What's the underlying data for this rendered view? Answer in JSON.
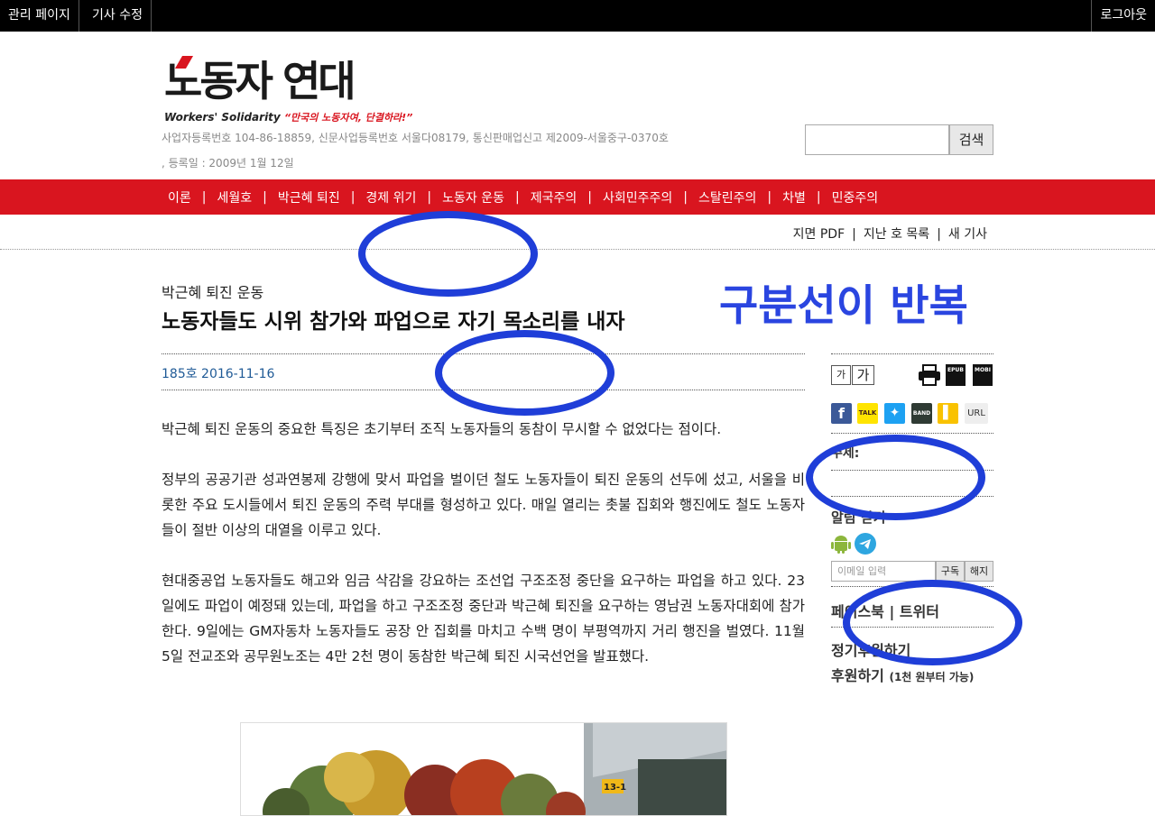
{
  "admin_bar": {
    "admin_page": "관리 페이지",
    "edit_article": "기사 수정",
    "logout": "로그아웃"
  },
  "header": {
    "logo_text": "노동자 연대",
    "logo_english": "Workers' Solidarity",
    "logo_slogan": "“만국의 노동자여, 단결하라!”",
    "registration_line1": "사업자등록번호 104-86-18859, 신문사업등록번호 서울다08179, 통신판매업신고 제2009-서울중구-0370호",
    "registration_line2": ", 등록일 : 2009년 1월 12일",
    "search_placeholder": "",
    "search_button": "검색"
  },
  "nav": {
    "items": [
      "이론",
      "세월호",
      "박근혜 퇴진",
      "경제 위기",
      "노동자 운동",
      "제국주의",
      "사회민주주의",
      "스탈린주의",
      "차별",
      "민중주의"
    ]
  },
  "subnav": {
    "pdf": "지면 PDF",
    "past_issues": "지난 호 목록",
    "new_articles": "새 기사"
  },
  "article": {
    "category": "박근혜 퇴진 운동",
    "title": "노동자들도 시위 참가와 파업으로 자기 목소리를 내자",
    "issue_date": "185호 2016-11-16",
    "paragraphs": [
      "박근혜 퇴진 운동의 중요한 특징은 초기부터 조직 노동자들의 동참이 무시할 수 없었다는 점이다.",
      "정부의 공공기관 성과연봉제 강행에 맞서 파업을 벌이던 철도 노동자들이 퇴진 운동의 선두에 섰고, 서울을 비롯한 주요 도시들에서 퇴진 운동의 주력 부대를 형성하고 있다. 매일 열리는 촛불 집회와 행진에도 철도 노동자들이 절반 이상의 대열을 이루고 있다.",
      "현대중공업 노동자들도 해고와 임금 삭감을 강요하는 조선업 구조조정 중단을 요구하는 파업을 하고 있다. 23일에도 파업이 예정돼 있는데, 파업을 하고 구조조정 중단과 박근혜 퇴진을 요구하는 영남권 노동자대회에 참가한다. 9일에는 GM자동차 노동자들도 공장 안 집회를 마치고 수백 명이 부평역까지 거리 행진을 벌였다. 11월 5일 전교조와 공무원노조는 4만 2천 명이 동참한 박근혜 퇴진 시국선언을 발표했다."
    ],
    "photo_sign": "13-1"
  },
  "annotation": {
    "text": "구분선이 반복",
    "color": "#1f3ed8"
  },
  "sidebar": {
    "font_small": "가",
    "font_large": "가",
    "epub": "EPUB",
    "mobi": "MOBI",
    "share": [
      "facebook-icon",
      "kakaotalk-icon",
      "twitter-icon",
      "band-icon",
      "kakaostory-icon"
    ],
    "talk_label": "TALK",
    "band_label": "BAND",
    "url_label": "URL",
    "topic_label": "주제:",
    "alert_label": "알림 받기",
    "email_placeholder": "이메일 입력",
    "subscribe": "구독",
    "unsubscribe": "해지",
    "social_links": "페이스북 | 트위터",
    "regular_support": "정기후원하기",
    "donate": "후원하기",
    "donate_note": "(1천 원부터 가능)"
  },
  "colors": {
    "brand_red": "#d9151f",
    "meta_blue": "#1f5a96",
    "annotation_blue": "#2a45e0"
  }
}
